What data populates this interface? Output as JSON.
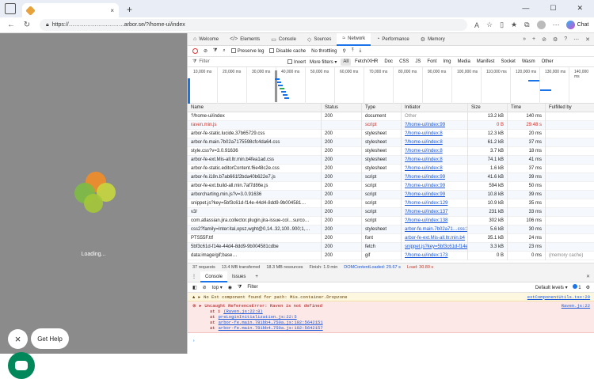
{
  "browser": {
    "url": "https://…………………………arbor.se/?/home-ui/index",
    "copilot_label": "Chat",
    "tab_close": "×",
    "new_tab": "+"
  },
  "app": {
    "loading_text": "Loading...",
    "help_label": "Get Help",
    "close_symbol": "×"
  },
  "devtools": {
    "tabs": [
      {
        "label": "Welcome",
        "icon": "⌂"
      },
      {
        "label": "Elements",
        "icon": "</>"
      },
      {
        "label": "Console",
        "icon": "▭"
      },
      {
        "label": "Sources",
        "icon": "◇"
      },
      {
        "label": "Network",
        "icon": "≈"
      },
      {
        "label": "Performance",
        "icon": "◔"
      },
      {
        "label": "Memory",
        "icon": "⚙"
      }
    ],
    "toolbar": {
      "preserve_log": "Preserve log",
      "disable_cache": "Disable cache",
      "throttling": "No throttling"
    },
    "filter": {
      "placeholder": "Filter",
      "invert": "Invert",
      "more_filters": "More filters ▾",
      "types": [
        "All",
        "Fetch/XHR",
        "Doc",
        "CSS",
        "JS",
        "Font",
        "Img",
        "Media",
        "Manifest",
        "Socket",
        "Wasm",
        "Other"
      ]
    },
    "timeline_ticks": [
      "10,000 ms",
      "20,000 ms",
      "30,000 ms",
      "40,000 ms",
      "50,000 ms",
      "60,000 ms",
      "70,000 ms",
      "80,000 ms",
      "90,000 ms",
      "100,000 ms",
      "110,000 ms",
      "120,000 ms",
      "130,000 ms",
      "140,000 ms"
    ],
    "columns": [
      "Name",
      "Status",
      "Type",
      "Initiator",
      "Size",
      "Time",
      "Fulfilled by"
    ],
    "rows": [
      {
        "name": "?/home-ui/index",
        "status": "200",
        "type": "document",
        "initiator": "Other",
        "size": "13.2 kB",
        "time": "140 ms",
        "error": false
      },
      {
        "name": "raven.min.js",
        "status": "",
        "type": "script",
        "initiator": "?/home-ui/index:99",
        "size": "0 B",
        "time": "29.48 s",
        "error": true
      },
      {
        "name": "arbor-fe-static.lucide.37b65729.css",
        "status": "200",
        "type": "stylesheet",
        "initiator": "?/home-ui/index:8",
        "size": "12.3 kB",
        "time": "20 ms",
        "error": false
      },
      {
        "name": "arbor-fe.main.7b02a7175598cfc4da64.css",
        "status": "200",
        "type": "stylesheet",
        "initiator": "?/home-ui/index:8",
        "size": "61.2 kB",
        "time": "37 ms",
        "error": false
      },
      {
        "name": "style.css?v=3.0.91636",
        "status": "200",
        "type": "stylesheet",
        "initiator": "?/home-ui/index:8",
        "size": "3.7 kB",
        "time": "18 ms",
        "error": false
      },
      {
        "name": "arbor-fe-ext.Mis-all.ltr.min.b4fea1ad.css",
        "status": "200",
        "type": "stylesheet",
        "initiator": "?/home-ui/index:8",
        "size": "74.1 kB",
        "time": "41 ms",
        "error": false
      },
      {
        "name": "arbor-fe-static.editorContent.f6e48c2e.css",
        "status": "200",
        "type": "stylesheet",
        "initiator": "?/home-ui/index:8",
        "size": "1.6 kB",
        "time": "37 ms",
        "error": false
      },
      {
        "name": "arbor-fe.i18n.b7ab661f2bda40b622e7.js",
        "status": "200",
        "type": "script",
        "initiator": "?/home-ui/index:99",
        "size": "41.6 kB",
        "time": "39 ms",
        "error": false
      },
      {
        "name": "arbor-fe-ext.build-all.min.7af7d86e.js",
        "status": "200",
        "type": "script",
        "initiator": "?/home-ui/index:99",
        "size": "594 kB",
        "time": "50 ms",
        "error": false
      },
      {
        "name": "arborcharting.min.js?v=3.0.91636",
        "status": "200",
        "type": "script",
        "initiator": "?/home-ui/index:99",
        "size": "10.8 kB",
        "time": "39 ms",
        "error": false
      },
      {
        "name": "snippet.js?key=5bf3c61d-f14e-44d4-8dd9-9b004581…",
        "status": "200",
        "type": "script",
        "initiator": "?/home-ui/index:129",
        "size": "10.9 kB",
        "time": "35 ms",
        "error": false
      },
      {
        "name": "v3/",
        "status": "200",
        "type": "script",
        "initiator": "?/home-ui/index:137",
        "size": "231 kB",
        "time": "33 ms",
        "error": false
      },
      {
        "name": "com.atlassian.jira.collector.plugin.jira-issue-col…surco…",
        "status": "200",
        "type": "script",
        "initiator": "?/home-ui/index:138",
        "size": "302 kB",
        "time": "106 ms",
        "error": false
      },
      {
        "name": "css2?family=Inter:ital,opsz,wght@0,14..32,100..900;1,…",
        "status": "200",
        "type": "stylesheet",
        "initiator": "arbor-fe.main.7b02a71…css:1",
        "size": "5.6 kB",
        "time": "30 ms",
        "error": false
      },
      {
        "name": "PTS55F.ttf",
        "status": "200",
        "type": "font",
        "initiator": "arbor-fe-ext.Mis-all.ltr.min.b4",
        "size": "35.1 kB",
        "time": "24 ms",
        "error": false
      },
      {
        "name": "5bf3c61d-f14e-44d4-8dd9-9b004581cdbe",
        "status": "200",
        "type": "fetch",
        "initiator": "snippet.js?key=5bf3c61d-f14e",
        "size": "3.3 kB",
        "time": "23 ms",
        "error": false
      },
      {
        "name": "data:image/gif;base…",
        "status": "200",
        "type": "gif",
        "initiator": "?/home-ui/index:173",
        "size": "0 B",
        "time": "0 ms",
        "fulfilled": "(memory cache)",
        "error": false
      }
    ],
    "status_bar": {
      "requests": "37 requests",
      "transferred": "13.4 MB transferred",
      "resources": "18.3 MB resources",
      "finish": "Finish: 1.9 min",
      "dcl": "DOMContentLoaded: 29.67 s",
      "load": "Load: 30.80 s"
    },
    "console": {
      "tabs": [
        "Console",
        "Issues"
      ],
      "context": "top ▾",
      "filter_placeholder": "Filter",
      "levels": "Default levels ▾",
      "issue_count": "1",
      "warning": {
        "text": "No Ext component found for path: Mis.container.Dropzone",
        "source": "extComponentUtils.tsx:29"
      },
      "error": {
        "text": "Uncaught ReferenceError: Raven is not defined",
        "source": "Raven.js:22",
        "stack": [
          {
            "prefix": "at i",
            "loc": "(Raven.js:22:8)"
          },
          {
            "prefix": "at",
            "loc": "preLoginInitialization.js:22:5"
          },
          {
            "prefix": "at",
            "loc": "arbor-fe.main.781bb4…750a.js:102:5642151"
          },
          {
            "prefix": "at",
            "loc": "arbor-fe.main.781bb4…750a.js:102:5642157"
          }
        ]
      },
      "prompt": "›"
    }
  },
  "colors": {
    "accent": "#1a73e8",
    "error": "#d93025",
    "help_green": "#00875a",
    "logo_orange": "#f28c28",
    "logo_lime": "#c5d63d",
    "logo_green": "#7dbb42"
  }
}
